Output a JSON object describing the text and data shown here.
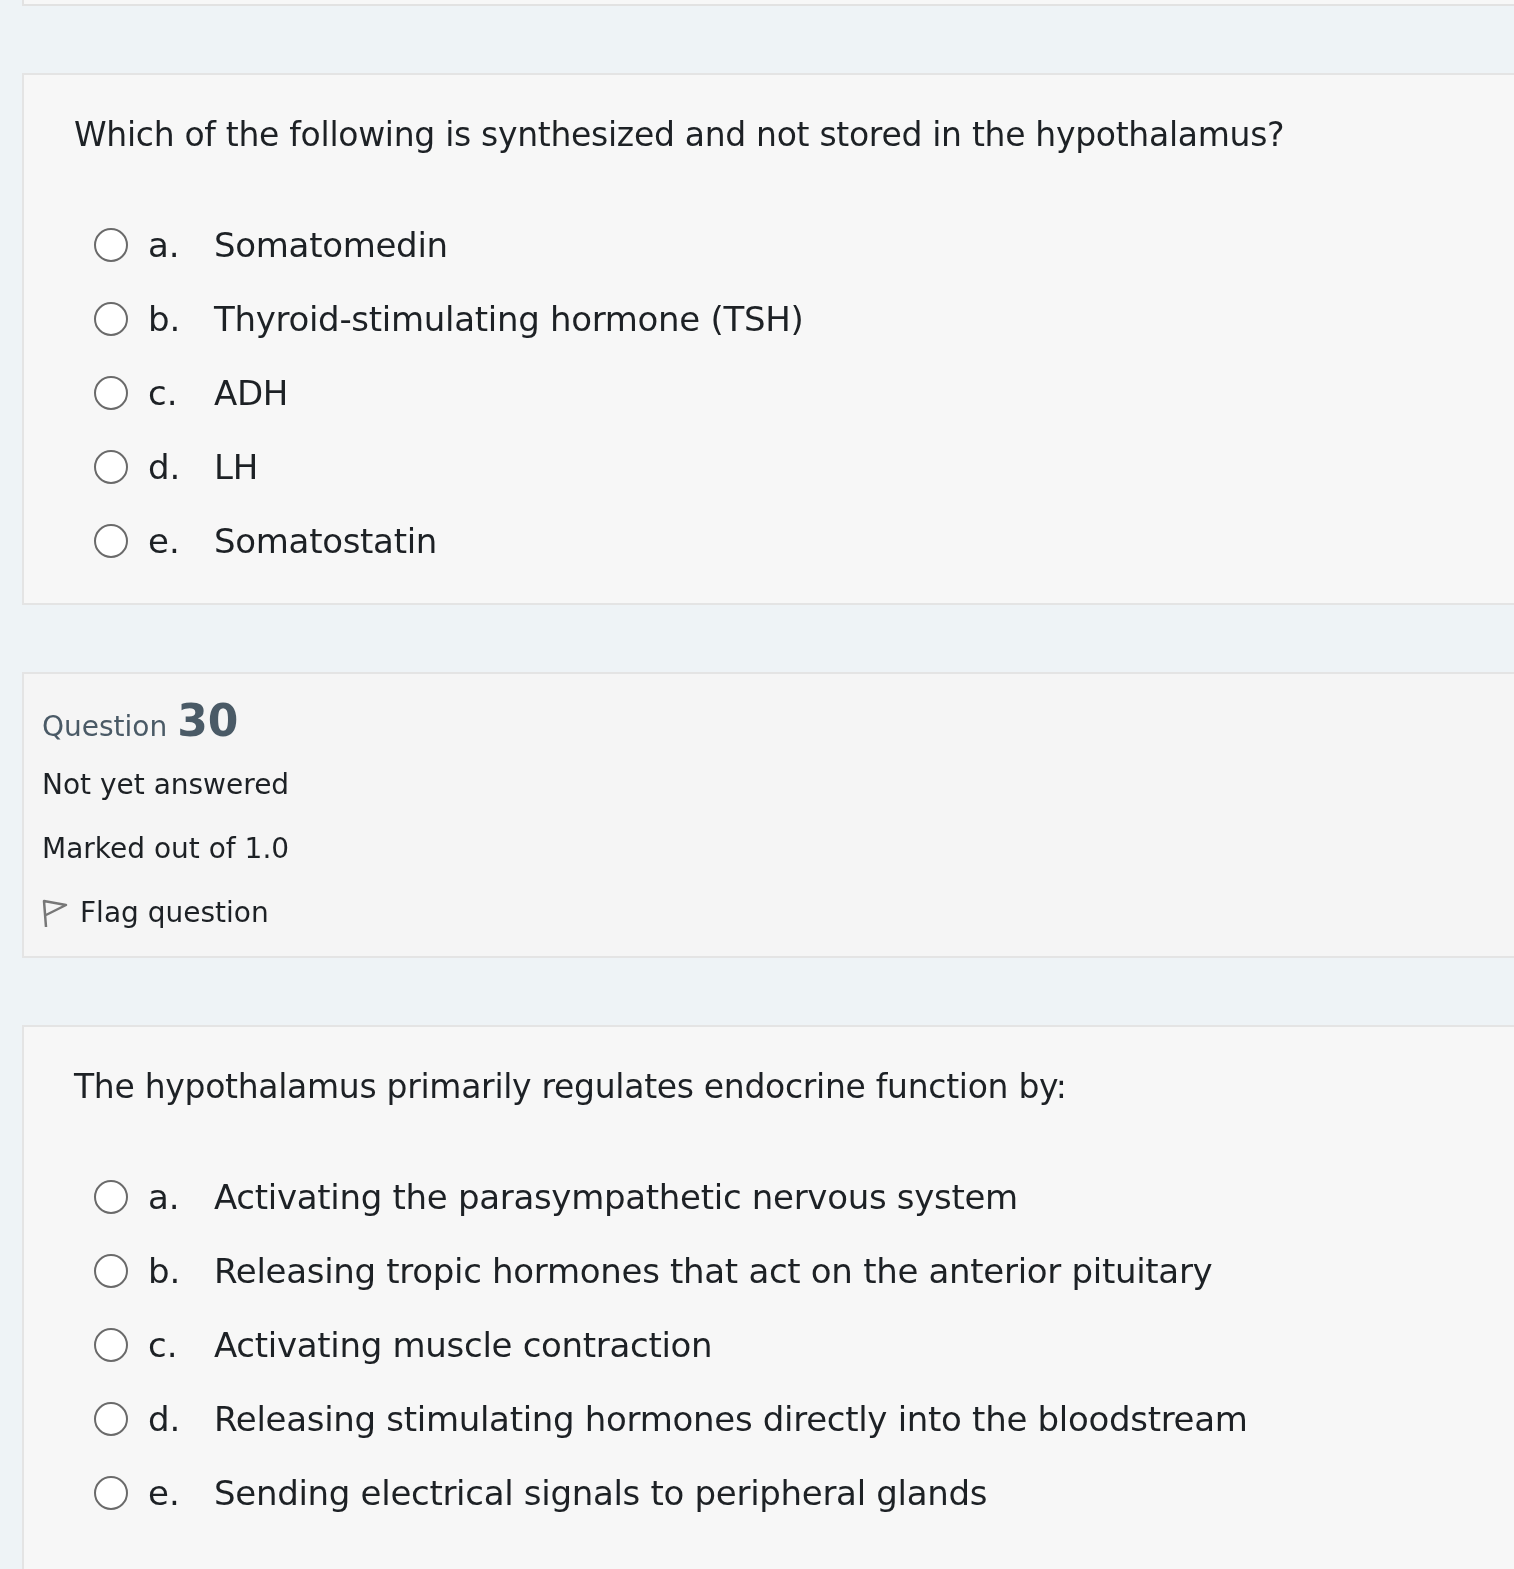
{
  "questions": [
    {
      "kind": "question",
      "text": "Which of the following is synthesized and not stored in the hypothalamus?",
      "options": [
        {
          "letter": "a.",
          "label": "Somatomedin",
          "selected": false
        },
        {
          "letter": "b.",
          "label": "Thyroid-stimulating hormone (TSH)",
          "selected": false
        },
        {
          "letter": "c.",
          "label": "ADH",
          "selected": false
        },
        {
          "letter": "d.",
          "label": "LH",
          "selected": false
        },
        {
          "letter": "e.",
          "label": "Somatostatin",
          "selected": false
        }
      ]
    },
    {
      "kind": "info",
      "label": "Question",
      "number": "30",
      "status": "Not yet answered",
      "marks": "Marked out of 1.0",
      "flag": "Flag question"
    },
    {
      "kind": "question",
      "text": "The hypothalamus primarily regulates endocrine function by:",
      "options": [
        {
          "letter": "a.",
          "label": "Activating the parasympathetic nervous system",
          "selected": false
        },
        {
          "letter": "b.",
          "label": "Releasing tropic hormones that act on the anterior pituitary",
          "selected": false
        },
        {
          "letter": "c.",
          "label": "Activating muscle contraction",
          "selected": false
        },
        {
          "letter": "d.",
          "label": "Releasing stimulating hormones directly into the bloodstream",
          "selected": false
        },
        {
          "letter": "e.",
          "label": "Sending electrical signals to peripheral glands",
          "selected": false
        }
      ]
    }
  ]
}
